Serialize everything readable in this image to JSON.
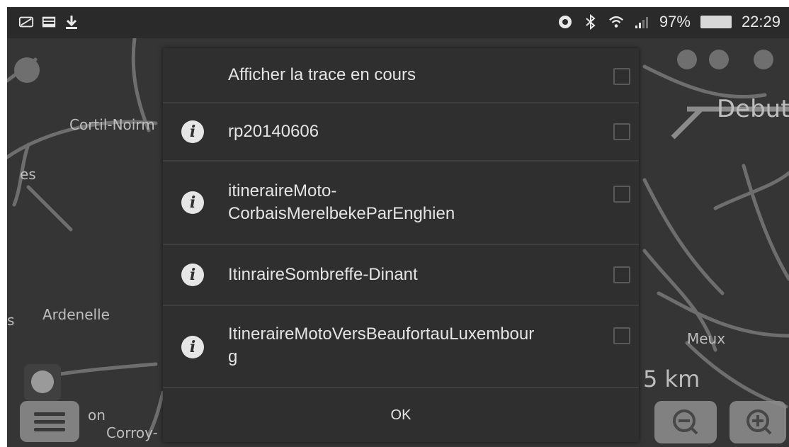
{
  "status_bar": {
    "battery": "97%",
    "time": "22:29"
  },
  "map": {
    "labels": [
      "Cortil-Noirm",
      "Ardenelle",
      "Corroy-",
      "Meux",
      "Debut",
      "5 km",
      "on",
      "es",
      "s"
    ]
  },
  "dialog": {
    "header_label": "Afficher la trace en cours",
    "items": [
      {
        "label": "rp20140606"
      },
      {
        "label": "itineraireMoto-\nCorbaisMerelbekeParEnghien"
      },
      {
        "label": "ItinraireSombreffe-Dinant"
      },
      {
        "label": "ItineraireMotoVersBeaufortauLuxembour\ng"
      }
    ],
    "ok_label": "OK"
  }
}
